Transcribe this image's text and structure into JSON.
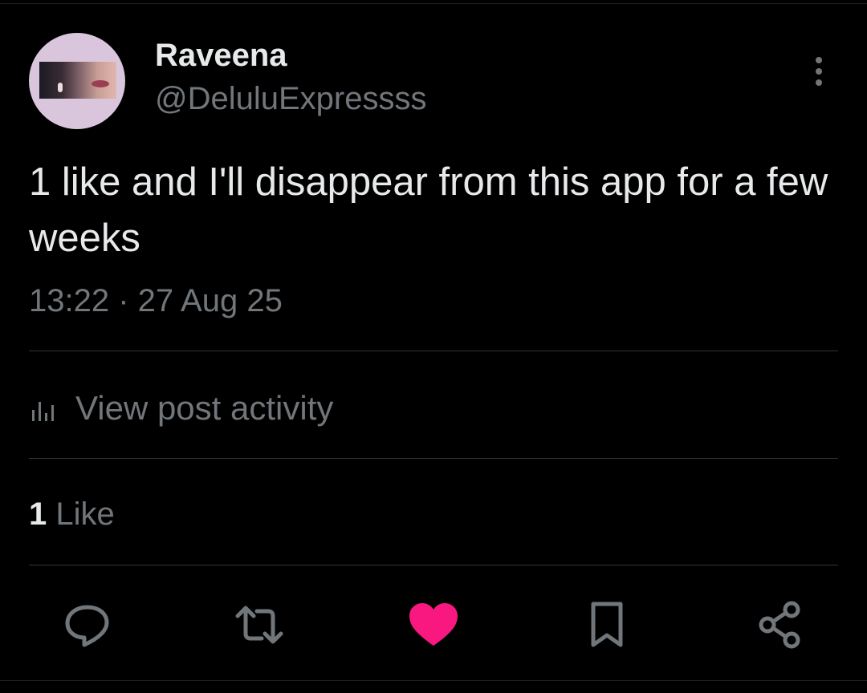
{
  "author": {
    "display_name": "Raveena",
    "handle": "@DeluluExpressss"
  },
  "post": {
    "text": "1 like and I'll disappear from this app for a few weeks",
    "timestamp": "13:22 · 27 Aug 25"
  },
  "activity": {
    "label": "View post activity",
    "icon": "bar-chart-icon"
  },
  "likes": {
    "count": "1",
    "label": "Like"
  },
  "actions": [
    {
      "icon": "reply-icon"
    },
    {
      "icon": "repost-icon"
    },
    {
      "icon": "heart-icon",
      "liked": true
    },
    {
      "icon": "bookmark-icon"
    },
    {
      "icon": "share-icon"
    }
  ],
  "colors": {
    "background": "#000000",
    "primary_text": "#e7e9ea",
    "secondary_text": "#71767b",
    "divider": "#2f3336",
    "like_pink": "#f91880",
    "avatar_bg": "#d9c6dd"
  }
}
